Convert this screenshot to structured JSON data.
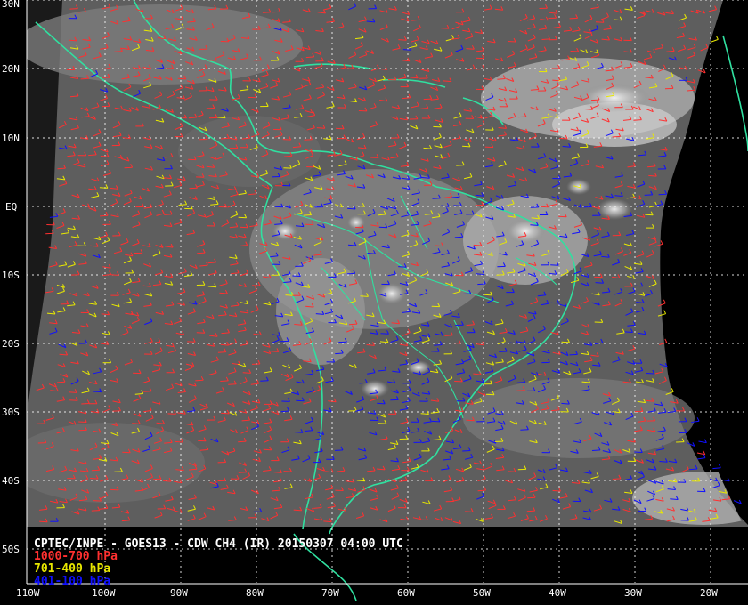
{
  "product_title": "CPTEC/INPE - GOES13 - CDW CH4 (IR) 20150307 04:00 UTC",
  "legend": [
    {
      "label": "1000-700 hPa",
      "color": "#ff3030"
    },
    {
      "label": "701-400 hPa",
      "color": "#e8e800"
    },
    {
      "label": "401-100 hPa",
      "color": "#1010ff"
    }
  ],
  "lat_labels": [
    "30N",
    "20N",
    "10N",
    "EQ",
    "10S",
    "20S",
    "30S",
    "40S",
    "50S"
  ],
  "lon_labels": [
    "110W",
    "100W",
    "90W",
    "80W",
    "70W",
    "60W",
    "50W",
    "40W",
    "30W",
    "20W"
  ],
  "colors": {
    "background": "#000000",
    "coastline": "#30e0a0",
    "grid": "#ffffff",
    "imagery": "#606060"
  }
}
